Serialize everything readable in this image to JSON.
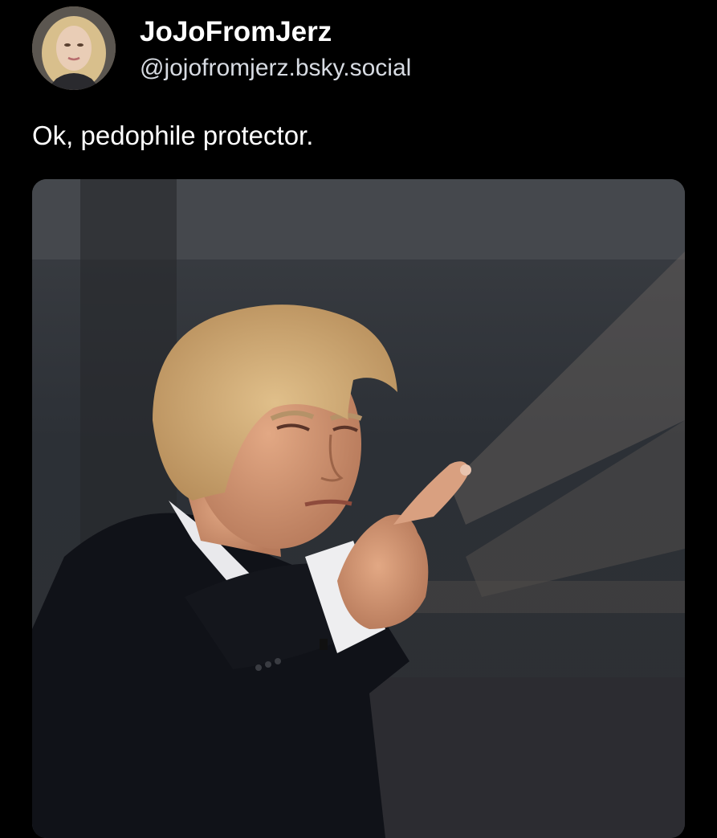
{
  "post": {
    "author": {
      "display_name": "JoJoFromJerz",
      "handle": "@jojofromjerz.bsky.social"
    },
    "text": "Ok, pedophile protector."
  }
}
